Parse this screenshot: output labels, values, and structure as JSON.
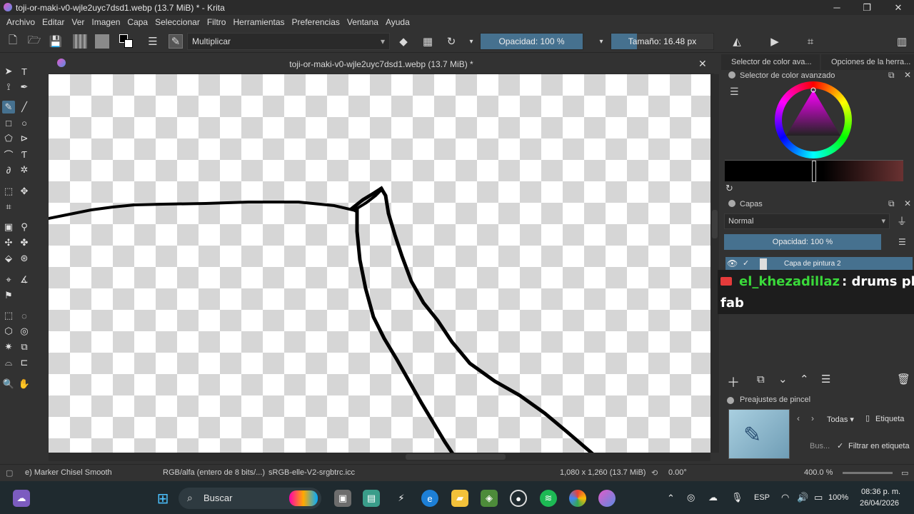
{
  "window": {
    "title": "toji-or-maki-v0-wjle2uyc7dsd1.webp (13.7 MiB) * - Krita"
  },
  "menu": [
    "Archivo",
    "Editar",
    "Ver",
    "Imagen",
    "Capa",
    "Seleccionar",
    "Filtro",
    "Herramientas",
    "Preferencias",
    "Ventana",
    "Ayuda"
  ],
  "toolbar": {
    "blend_mode": "Multiplicar",
    "opacity": "Opacidad: 100 %",
    "opacity_fraction": 1.0,
    "size": "Tamaño: 16.48 px"
  },
  "document": {
    "tab_title": "toji-or-maki-v0-wjle2uyc7dsd1.webp (13.7 MiB) *"
  },
  "dock": {
    "tab1": "Selector de color ava...",
    "tab2": "Opciones de la herra...",
    "color_panel_title": "Selector de color avanzado",
    "layers_title": "Capas",
    "layer_blend": "Normal",
    "layer_opacity": "Opacidad:  100 %",
    "layer_name": "Capa de pintura 2",
    "brush_presets_title": "Preajustes de pincel",
    "presets_filter": "Todas",
    "tag_label": "Etiqueta",
    "search_placeholder": "Bus...",
    "filter_tag": "Filtrar en etiqueta"
  },
  "chat": {
    "user": "el_khezadillaz",
    "message": ": drums pleas",
    "message2": "fab"
  },
  "status": {
    "brush": "e) Marker Chisel Smooth",
    "color_space": "RGB/alfa (entero de 8 bits/...)",
    "profile": "sRGB-elle-V2-srgbtrc.icc",
    "dimensions": "1,080 x 1,260 (13.7 MiB)",
    "rotation": "0.00°",
    "zoom": "400.0 %"
  },
  "taskbar": {
    "search": "Buscar",
    "lang": "ESP",
    "battery": "100%",
    "time": "08:36 p. m.",
    "date": "26/04/2026"
  }
}
